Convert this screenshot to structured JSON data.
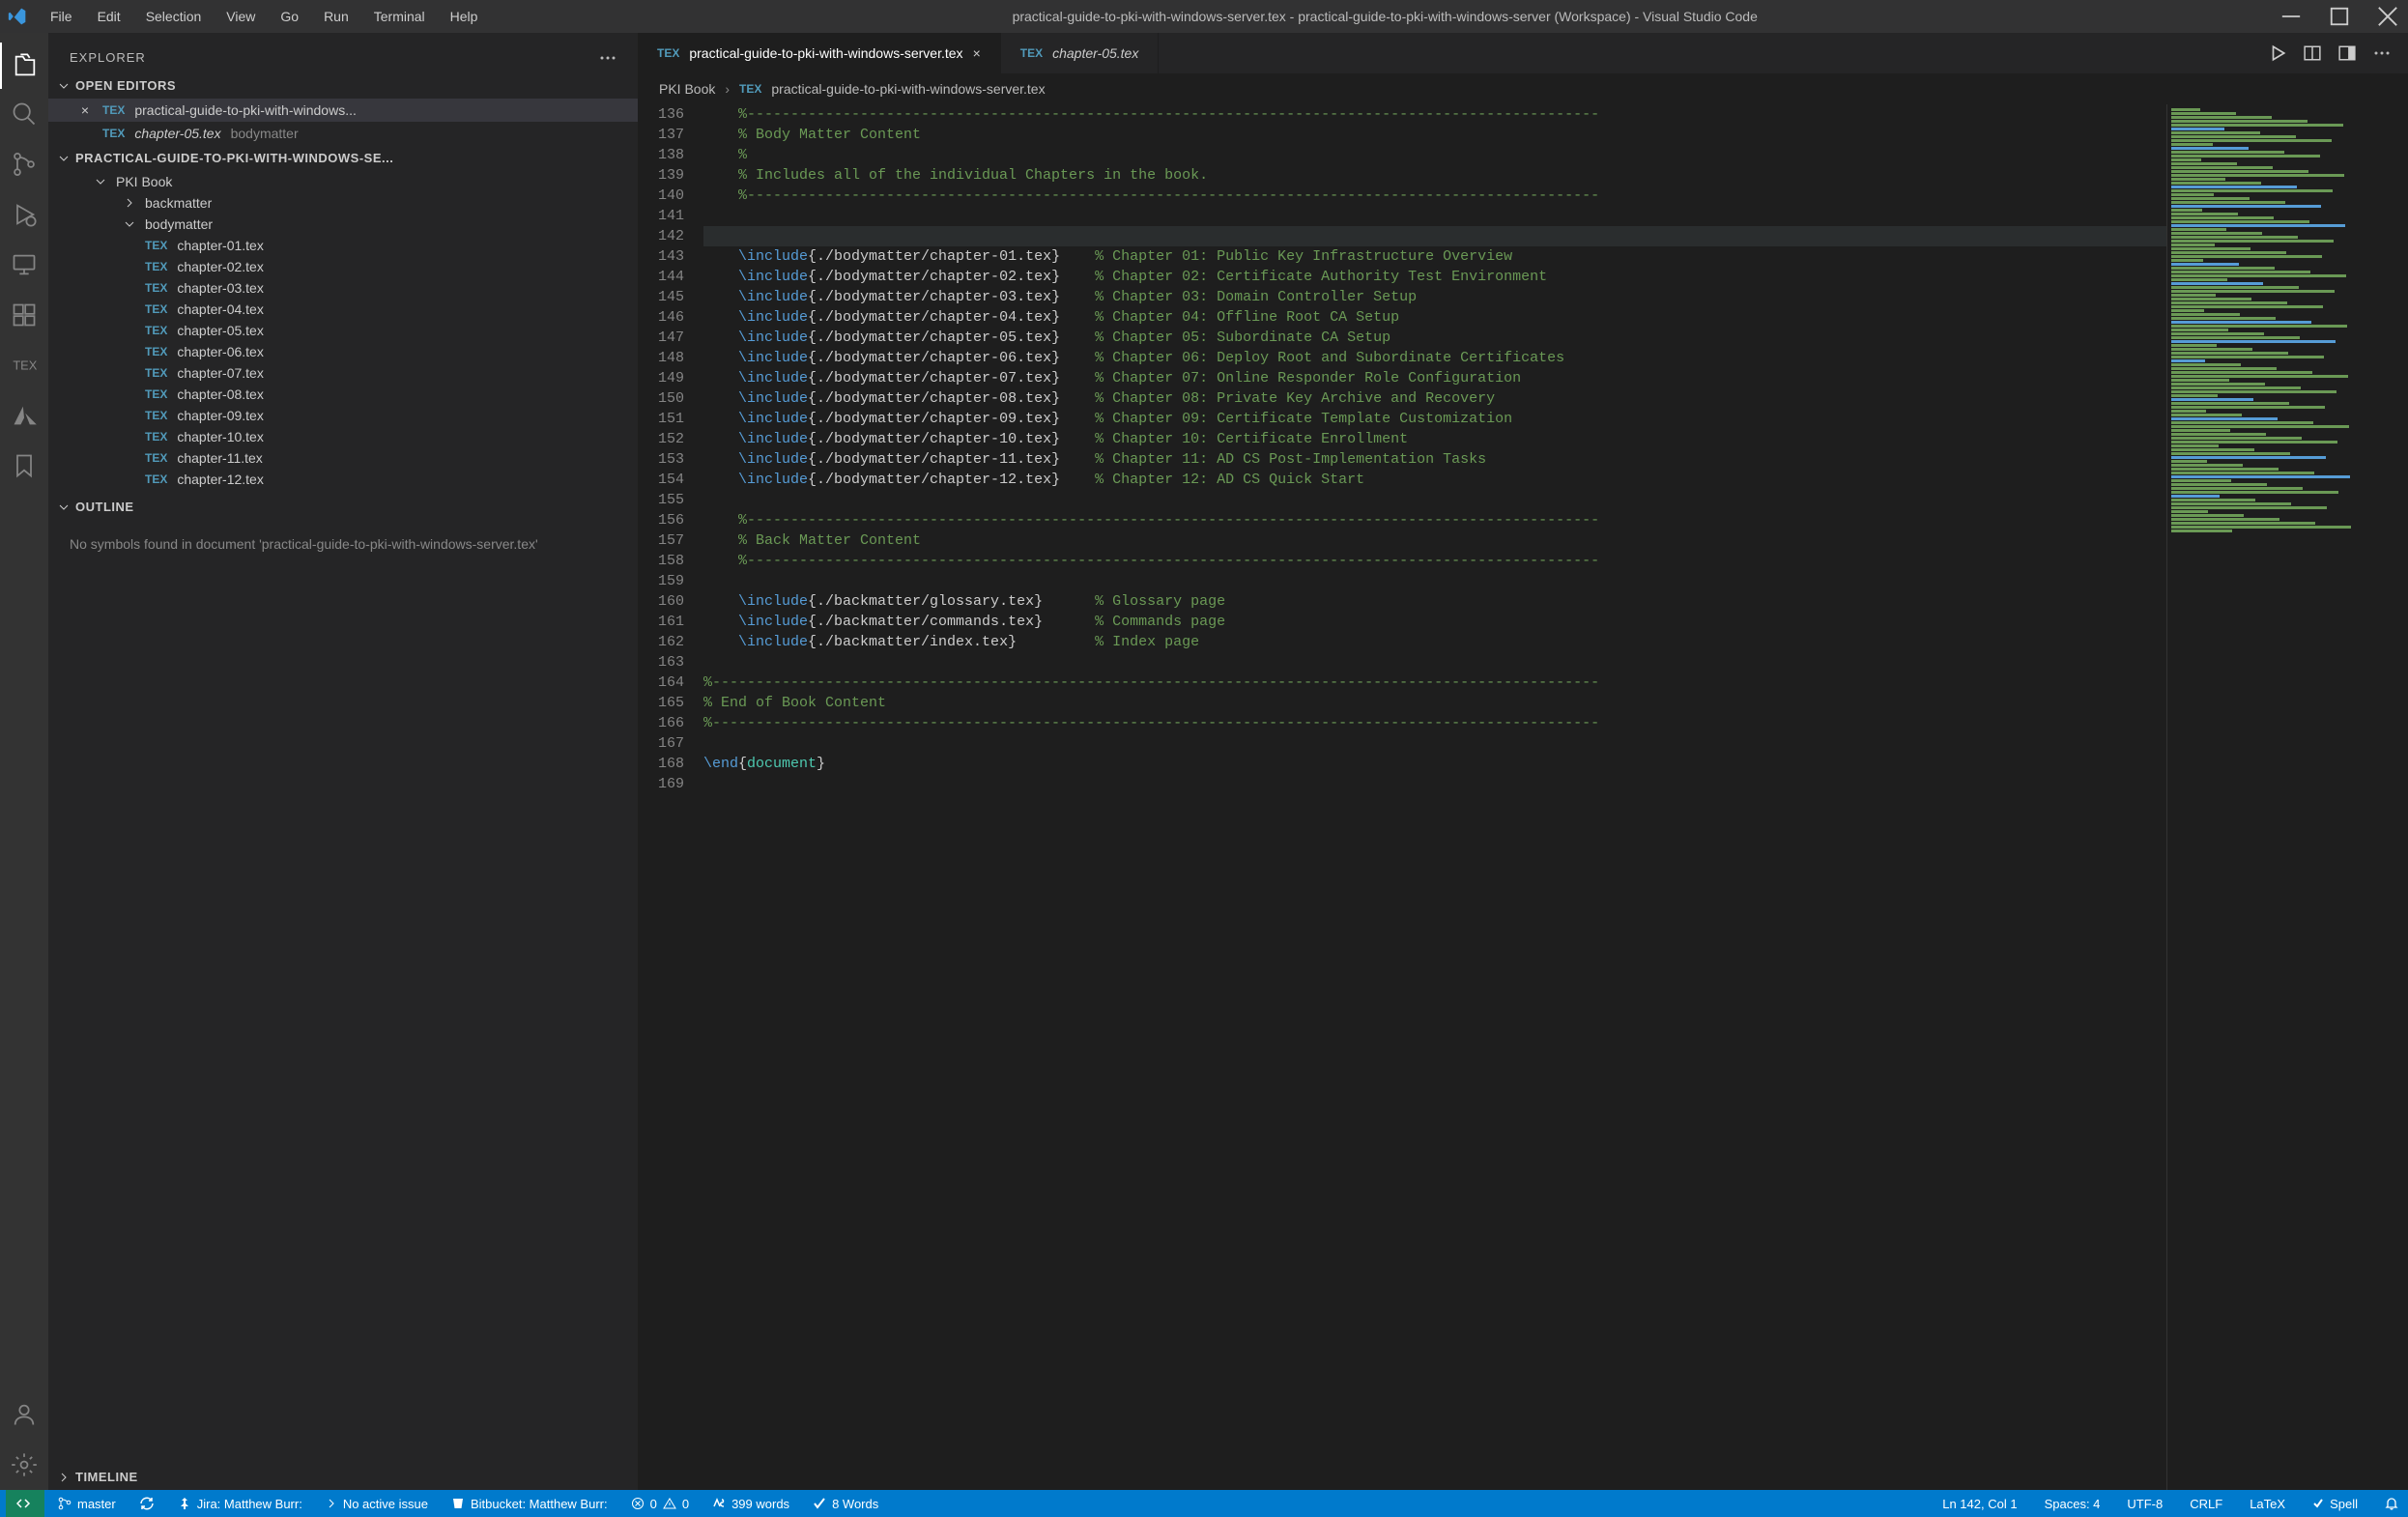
{
  "titlebar": {
    "menus": [
      "File",
      "Edit",
      "Selection",
      "View",
      "Go",
      "Run",
      "Terminal",
      "Help"
    ],
    "title": "practical-guide-to-pki-with-windows-server.tex - practical-guide-to-pki-with-windows-server (Workspace) - Visual Studio Code"
  },
  "sidebar": {
    "title": "EXPLORER",
    "sections": {
      "open_editors": {
        "label": "OPEN EDITORS",
        "items": [
          {
            "label": "practical-guide-to-pki-with-windows...",
            "active": true
          },
          {
            "label": "chapter-05.tex",
            "suffix": "bodymatter",
            "italic": true
          }
        ]
      },
      "workspace": {
        "label": "PRACTICAL-GUIDE-TO-PKI-WITH-WINDOWS-SE...",
        "root": "PKI Book",
        "folders": [
          {
            "name": "backmatter",
            "expanded": false
          },
          {
            "name": "bodymatter",
            "expanded": true
          }
        ],
        "files": [
          "chapter-01.tex",
          "chapter-02.tex",
          "chapter-03.tex",
          "chapter-04.tex",
          "chapter-05.tex",
          "chapter-06.tex",
          "chapter-07.tex",
          "chapter-08.tex",
          "chapter-09.tex",
          "chapter-10.tex",
          "chapter-11.tex",
          "chapter-12.tex"
        ]
      },
      "outline": {
        "label": "OUTLINE",
        "message": "No symbols found in document 'practical-guide-to-pki-with-windows-server.tex'"
      },
      "timeline": {
        "label": "TIMELINE"
      }
    }
  },
  "tabs": [
    {
      "label": "practical-guide-to-pki-with-windows-server.tex",
      "active": true,
      "icon": "tex"
    },
    {
      "label": "chapter-05.tex",
      "active": false,
      "icon": "tex",
      "italic": true
    }
  ],
  "breadcrumbs": {
    "root": "PKI Book",
    "file": "practical-guide-to-pki-with-windows-server.tex"
  },
  "editor": {
    "first_line": 136,
    "lines": [
      {
        "n": 136,
        "type": "comment",
        "text": "%--------------------------------------------------------------------------------------------------"
      },
      {
        "n": 137,
        "type": "comment",
        "text": "% Body Matter Content"
      },
      {
        "n": 138,
        "type": "comment",
        "text": "%"
      },
      {
        "n": 139,
        "type": "comment",
        "text": "% Includes all of the individual Chapters in the book."
      },
      {
        "n": 140,
        "type": "comment",
        "text": "%--------------------------------------------------------------------------------------------------"
      },
      {
        "n": 141,
        "type": "blank",
        "text": ""
      },
      {
        "n": 142,
        "type": "blank",
        "text": "",
        "current": true
      },
      {
        "n": 143,
        "type": "include",
        "path": "./bodymatter/chapter-01.tex",
        "comment": "% Chapter 01: Public Key Infrastructure Overview"
      },
      {
        "n": 144,
        "type": "include",
        "path": "./bodymatter/chapter-02.tex",
        "comment": "% Chapter 02: Certificate Authority Test Environment"
      },
      {
        "n": 145,
        "type": "include",
        "path": "./bodymatter/chapter-03.tex",
        "comment": "% Chapter 03: Domain Controller Setup"
      },
      {
        "n": 146,
        "type": "include",
        "path": "./bodymatter/chapter-04.tex",
        "comment": "% Chapter 04: Offline Root CA Setup"
      },
      {
        "n": 147,
        "type": "include",
        "path": "./bodymatter/chapter-05.tex",
        "comment": "% Chapter 05: Subordinate CA Setup"
      },
      {
        "n": 148,
        "type": "include",
        "path": "./bodymatter/chapter-06.tex",
        "comment": "% Chapter 06: Deploy Root and Subordinate Certificates"
      },
      {
        "n": 149,
        "type": "include",
        "path": "./bodymatter/chapter-07.tex",
        "comment": "% Chapter 07: Online Responder Role Configuration"
      },
      {
        "n": 150,
        "type": "include",
        "path": "./bodymatter/chapter-08.tex",
        "comment": "% Chapter 08: Private Key Archive and Recovery"
      },
      {
        "n": 151,
        "type": "include",
        "path": "./bodymatter/chapter-09.tex",
        "comment": "% Chapter 09: Certificate Template Customization"
      },
      {
        "n": 152,
        "type": "include",
        "path": "./bodymatter/chapter-10.tex",
        "comment": "% Chapter 10: Certificate Enrollment"
      },
      {
        "n": 153,
        "type": "include",
        "path": "./bodymatter/chapter-11.tex",
        "comment": "% Chapter 11: AD CS Post-Implementation Tasks"
      },
      {
        "n": 154,
        "type": "include",
        "path": "./bodymatter/chapter-12.tex",
        "comment": "% Chapter 12: AD CS Quick Start"
      },
      {
        "n": 155,
        "type": "blank",
        "text": ""
      },
      {
        "n": 156,
        "type": "comment",
        "text": "%--------------------------------------------------------------------------------------------------"
      },
      {
        "n": 157,
        "type": "comment",
        "text": "% Back Matter Content"
      },
      {
        "n": 158,
        "type": "comment",
        "text": "%--------------------------------------------------------------------------------------------------"
      },
      {
        "n": 159,
        "type": "blank",
        "text": ""
      },
      {
        "n": 160,
        "type": "include",
        "path": "./backmatter/glossary.tex",
        "comment": "% Glossary page",
        "pad": true
      },
      {
        "n": 161,
        "type": "include",
        "path": "./backmatter/commands.tex",
        "comment": "% Commands page",
        "pad": true
      },
      {
        "n": 162,
        "type": "include",
        "path": "./backmatter/index.tex",
        "comment": "% Index page",
        "pad": true
      },
      {
        "n": 163,
        "type": "blank",
        "text": ""
      },
      {
        "n": 164,
        "type": "comment",
        "text": "%------------------------------------------------------------------------------------------------------",
        "outdent": true
      },
      {
        "n": 165,
        "type": "comment",
        "text": "% End of Book Content",
        "outdent": true
      },
      {
        "n": 166,
        "type": "comment",
        "text": "%------------------------------------------------------------------------------------------------------",
        "outdent": true
      },
      {
        "n": 167,
        "type": "blank",
        "text": "",
        "outdent": true
      },
      {
        "n": 168,
        "type": "end",
        "keyword": "\\end",
        "arg": "document",
        "outdent": true
      },
      {
        "n": 169,
        "type": "blank",
        "text": "",
        "outdent": true
      }
    ]
  },
  "status": {
    "branch": "master",
    "jira_label": "Jira: Matthew Burr:",
    "issue": "No active issue",
    "bitbucket": "Bitbucket: Matthew Burr:",
    "errors": "0",
    "warnings": "0",
    "words": "399 words",
    "words2": "8 Words",
    "position": "Ln 142, Col 1",
    "spaces": "Spaces: 4",
    "encoding": "UTF-8",
    "eol": "CRLF",
    "language": "LaTeX",
    "spell": "Spell"
  }
}
